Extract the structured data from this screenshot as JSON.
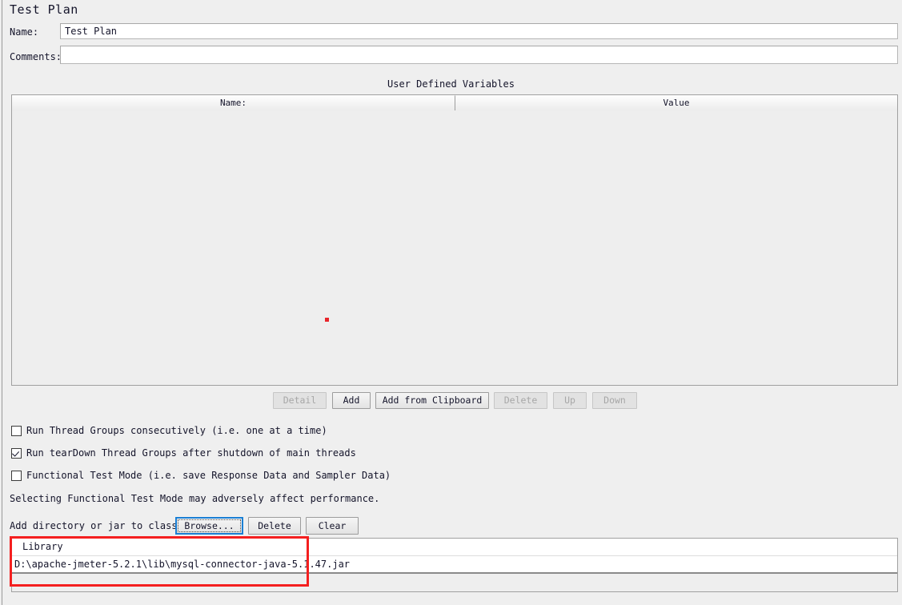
{
  "title": "Test Plan",
  "form": {
    "name_label": "Name:",
    "name_value": "Test Plan",
    "comments_label": "Comments:",
    "comments_value": "",
    "comments_placeholder": ""
  },
  "user_defined_variables": {
    "caption": "User Defined Variables",
    "columns": [
      "Name:",
      "Value"
    ],
    "rows": []
  },
  "variable_buttons": [
    {
      "label": "Detail",
      "enabled": false
    },
    {
      "label": "Add",
      "enabled": true
    },
    {
      "label": "Add from Clipboard",
      "enabled": true
    },
    {
      "label": "Delete",
      "enabled": false
    },
    {
      "label": "Up",
      "enabled": false
    },
    {
      "label": "Down",
      "enabled": false
    }
  ],
  "checkboxes": [
    {
      "label": "Run Thread Groups consecutively (i.e. one at a time)",
      "checked": false
    },
    {
      "label": "Run tearDown Thread Groups after shutdown of main threads",
      "checked": true
    },
    {
      "label": "Functional Test Mode (i.e. save Response Data and Sampler Data)",
      "checked": false
    }
  ],
  "note": "Selecting Functional Test Mode may adversely affect performance.",
  "classpath": {
    "label": "Add directory or jar to classpath",
    "browse_label": "Browse...",
    "delete_label": "Delete",
    "clear_label": "Clear"
  },
  "library_table": {
    "column": "Library",
    "rows": [
      "D:\\apache-jmeter-5.2.1\\lib\\mysql-connector-java-5.1.47.jar"
    ]
  },
  "annotation": {
    "color": "#f41f1f"
  },
  "colors": {
    "background": "#efefef",
    "field_background": "#ffffff",
    "table_background": "#eeeeee",
    "text": "#14142a",
    "disabled_text": "#a7a7a7",
    "focus_border": "#1a7fd4",
    "annotation_red": "#f41f1f",
    "marker_red": "#e8252a"
  }
}
